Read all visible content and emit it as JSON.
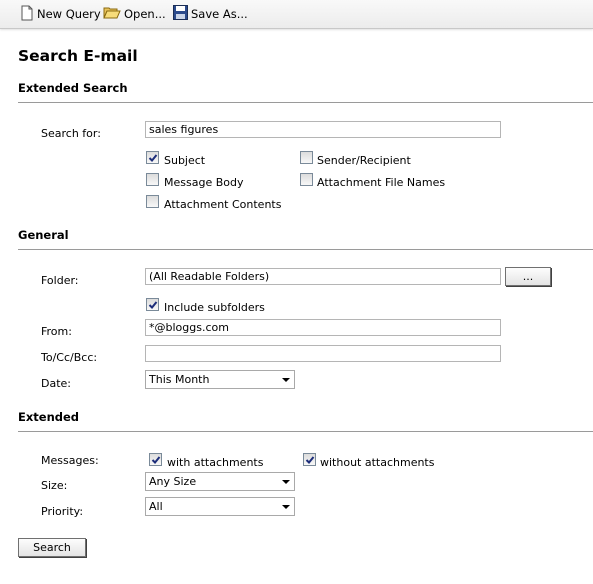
{
  "toolbar": {
    "new_query": "New Query",
    "open": "Open...",
    "save_as": "Save As..."
  },
  "page": {
    "title": "Search E-mail"
  },
  "extended_search": {
    "heading": "Extended Search",
    "search_for_label": "Search for:",
    "search_for_value": "sales figures",
    "options": [
      {
        "label": "Subject",
        "checked": true
      },
      {
        "label": "Sender/Recipient",
        "checked": false
      },
      {
        "label": "Message Body",
        "checked": false
      },
      {
        "label": "Attachment File Names",
        "checked": false
      },
      {
        "label": "Attachment Contents",
        "checked": false
      }
    ]
  },
  "general": {
    "heading": "General",
    "folder_label": "Folder:",
    "folder_value": "(All Readable Folders)",
    "browse_label": "...",
    "include_subfolders_label": "Include subfolders",
    "include_subfolders_checked": true,
    "from_label": "From:",
    "from_value": "*@bloggs.com",
    "to_label": "To/Cc/Bcc:",
    "to_value": "",
    "date_label": "Date:",
    "date_value": "This Month"
  },
  "extended": {
    "heading": "Extended",
    "messages_label": "Messages:",
    "with_attachments_label": "with attachments",
    "with_attachments_checked": true,
    "without_attachments_label": "without attachments",
    "without_attachments_checked": true,
    "size_label": "Size:",
    "size_value": "Any Size",
    "priority_label": "Priority:",
    "priority_value": "All"
  },
  "search_button_label": "Search"
}
